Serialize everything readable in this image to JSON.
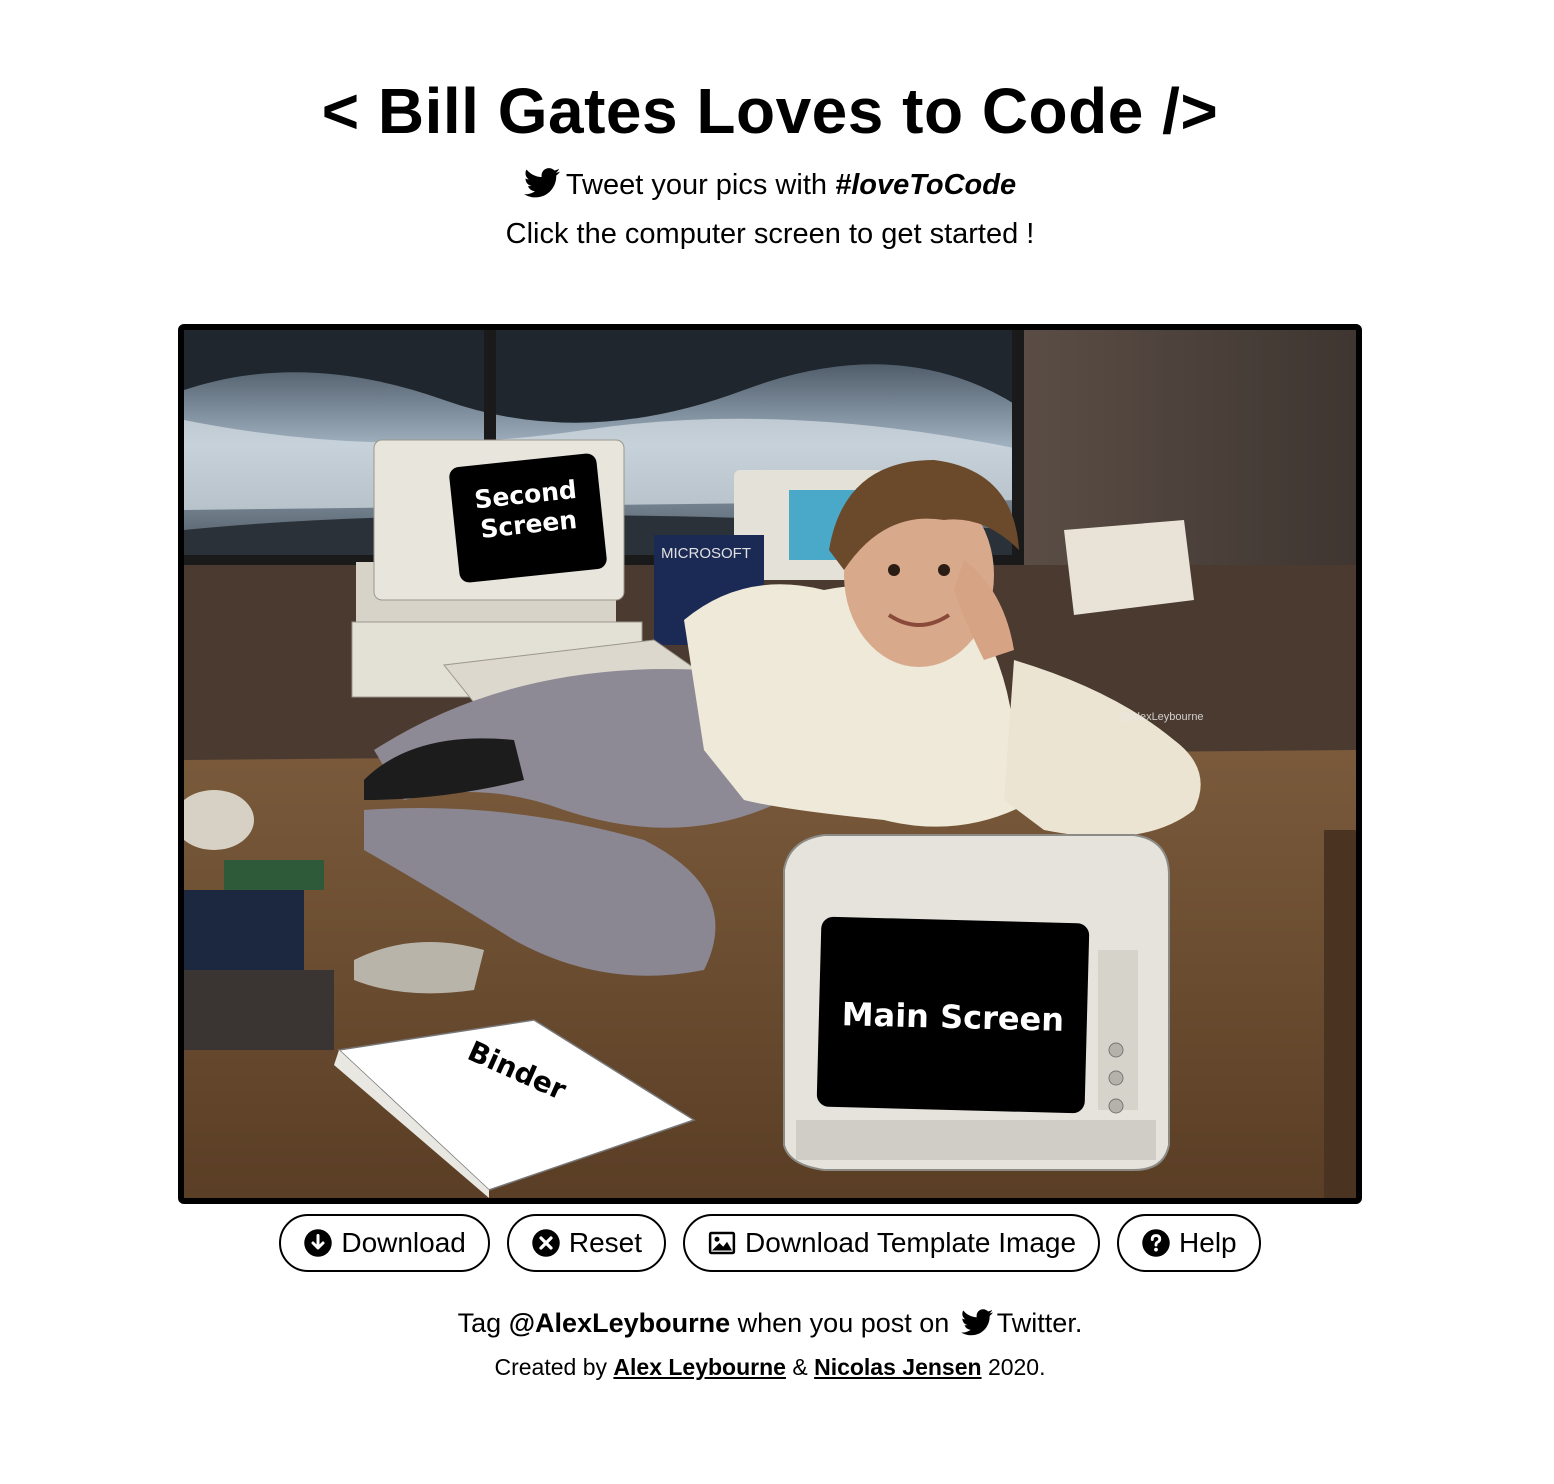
{
  "header": {
    "title": "< Bill Gates Loves to Code />",
    "tweet_prefix": "Tweet your pics with",
    "hashtag": "#loveToCode",
    "instruction": "Click the computer screen to get started !"
  },
  "photo": {
    "second_screen_label_line1": "Second",
    "second_screen_label_line2": "Screen",
    "main_screen_label": "Main Screen",
    "binder_label": "Binder",
    "monitor_brand": "MICROSOFT",
    "watermark": "@AlexLeybourne"
  },
  "buttons": {
    "download": "Download",
    "reset": "Reset",
    "download_template": "Download Template Image",
    "help": "Help"
  },
  "footer": {
    "tag_prefix": "Tag",
    "handle": "@AlexLeybourne",
    "tag_middle": "when you post on",
    "platform": "Twitter.",
    "created_by": "Created by",
    "author1": "Alex Leybourne",
    "amp": "&",
    "author2": "Nicolas Jensen",
    "year": "2020."
  },
  "icons": {
    "twitter": "twitter-bird-icon",
    "download": "arrow-down-circle-icon",
    "reset": "x-circle-icon",
    "template": "image-icon",
    "help": "question-circle-icon"
  }
}
